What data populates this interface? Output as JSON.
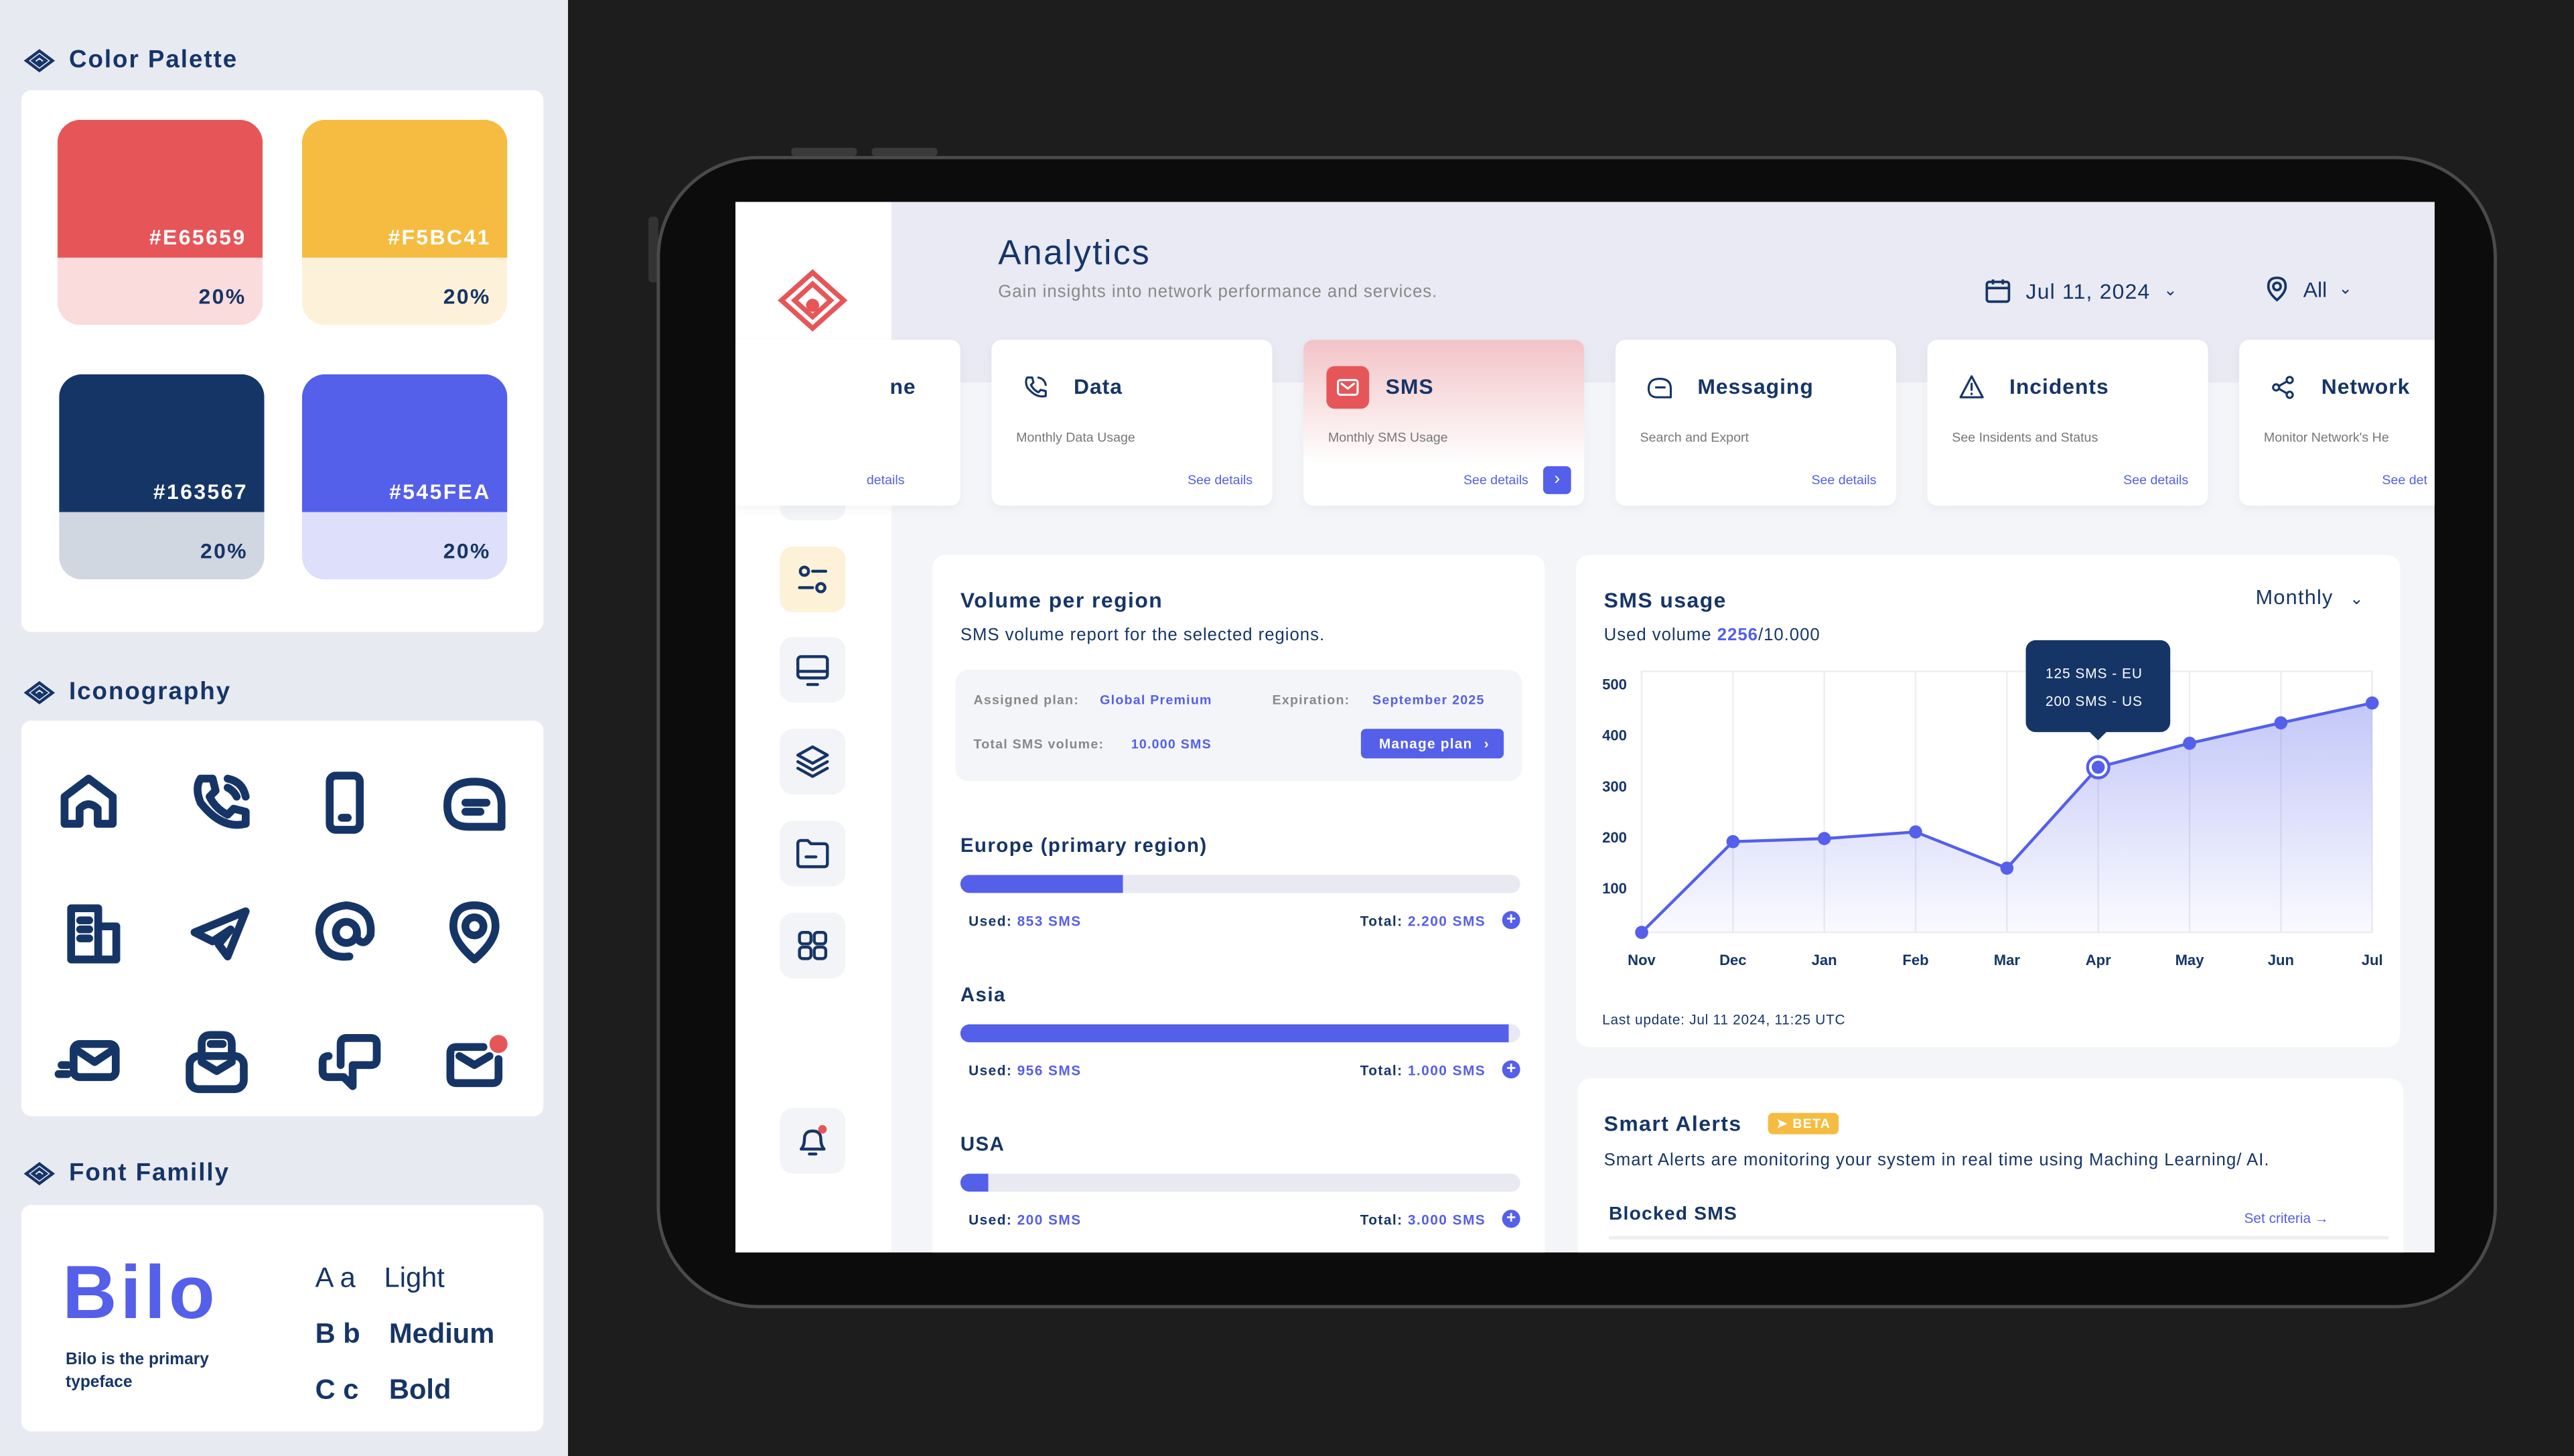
{
  "left": {
    "palette": {
      "title": "Color Palette",
      "swatches": [
        {
          "hex": "#E65659",
          "tint": "20%",
          "color": "#E65659",
          "tint_color": "#FADCDD"
        },
        {
          "hex": "#F5BC41",
          "tint": "20%",
          "color": "#F5BC41",
          "tint_color": "#FDF2D9"
        },
        {
          "hex": "#163567",
          "tint": "20%",
          "color": "#163567",
          "tint_color": "#D0D7E1"
        },
        {
          "hex": "#545FEA",
          "tint": "20%",
          "color": "#545FEA",
          "tint_color": "#DDDFFB"
        }
      ]
    },
    "iconography": {
      "title": "Iconography",
      "icons": [
        "home-icon",
        "phone-call-icon",
        "mobile-icon",
        "message-icon",
        "document-icon",
        "send-icon",
        "at-icon",
        "location-pin-icon",
        "fast-mail-icon",
        "mailbox-icon",
        "chat-bubbles-icon",
        "mail-notification-icon"
      ]
    },
    "font": {
      "title": "Font Familly",
      "name": "Bilo",
      "caption_line1": "Bilo  is the primary",
      "caption_line2": "typeface",
      "weights": [
        {
          "sample": "A a",
          "label": "Light"
        },
        {
          "sample": "B b",
          "label": "Medium"
        },
        {
          "sample": "C c",
          "label": "Bold"
        }
      ]
    }
  },
  "app": {
    "header": {
      "title": "Analytics",
      "subtitle": "Gain insights into network performance and services.",
      "date": "Jul 11, 2024",
      "region": "All"
    },
    "services": [
      {
        "title": "ne",
        "subtitle": "",
        "link": "details"
      },
      {
        "title": "Data",
        "subtitle": "Monthly Data Usage",
        "link": "See details",
        "icon": "phone-icon"
      },
      {
        "title": "SMS",
        "subtitle": "Monthly SMS Usage",
        "link": "See details",
        "icon": "mail-icon",
        "active": true
      },
      {
        "title": "Messaging",
        "subtitle": "Search and Export",
        "link": "See details",
        "icon": "message-icon"
      },
      {
        "title": "Incidents",
        "subtitle": "See Insidents and Status",
        "link": "See details",
        "icon": "warning-icon"
      },
      {
        "title": "Network",
        "subtitle": "Monitor Network's He",
        "link": "See det",
        "icon": "share-icon"
      }
    ],
    "volume": {
      "title": "Volume per region",
      "subtitle": "SMS volume report for the selected regions.",
      "plan_label": "Assigned plan:",
      "plan": "Global Premium",
      "exp_label": "Expiration:",
      "expiration": "September 2025",
      "total_label": "Total SMS volume:",
      "total": "10.000 SMS",
      "manage": "Manage plan",
      "regions": [
        {
          "name": "Europe (primary region)",
          "used_label": "Used:",
          "used": "853 SMS",
          "total_label": "Total:",
          "total": "2.200 SMS",
          "fill_pct": 29
        },
        {
          "name": "Asia",
          "used_label": "Used:",
          "used": "956 SMS",
          "total_label": "Total:",
          "total": "1.000 SMS",
          "fill_pct": 98
        },
        {
          "name": "USA",
          "used_label": "Used:",
          "used": "200 SMS",
          "total_label": "Total:",
          "total": "3.000 SMS",
          "fill_pct": 5
        }
      ]
    },
    "usage": {
      "title": "SMS usage",
      "period": "Monthly",
      "used_prefix": "Used volume ",
      "used": "2256",
      "used_suffix": "/10.000",
      "tooltip_line1": "125 SMS - EU",
      "tooltip_line2": "200 SMS - US",
      "last_update": "Last update: Jul 11 2024, 11:25 UTC"
    },
    "alerts": {
      "title": "Smart Alerts",
      "badge": "BETA",
      "desc": "Smart Alerts are monitoring your system in real time using Maching Learning/ AI.",
      "blocked": "Blocked SMS",
      "criteria": "Set criteria"
    }
  },
  "chart_data": {
    "type": "area",
    "categories": [
      "Nov",
      "Dec",
      "Jan",
      "Feb",
      "Mar",
      "Apr",
      "May",
      "Jun",
      "Jul"
    ],
    "values": [
      14,
      192,
      198,
      211,
      140,
      338,
      385,
      425,
      464
    ],
    "yticks": [
      100,
      200,
      300,
      400,
      500
    ],
    "ylim": [
      14,
      526
    ],
    "highlight": "Apr",
    "grid": true,
    "color": "#545FEA"
  }
}
